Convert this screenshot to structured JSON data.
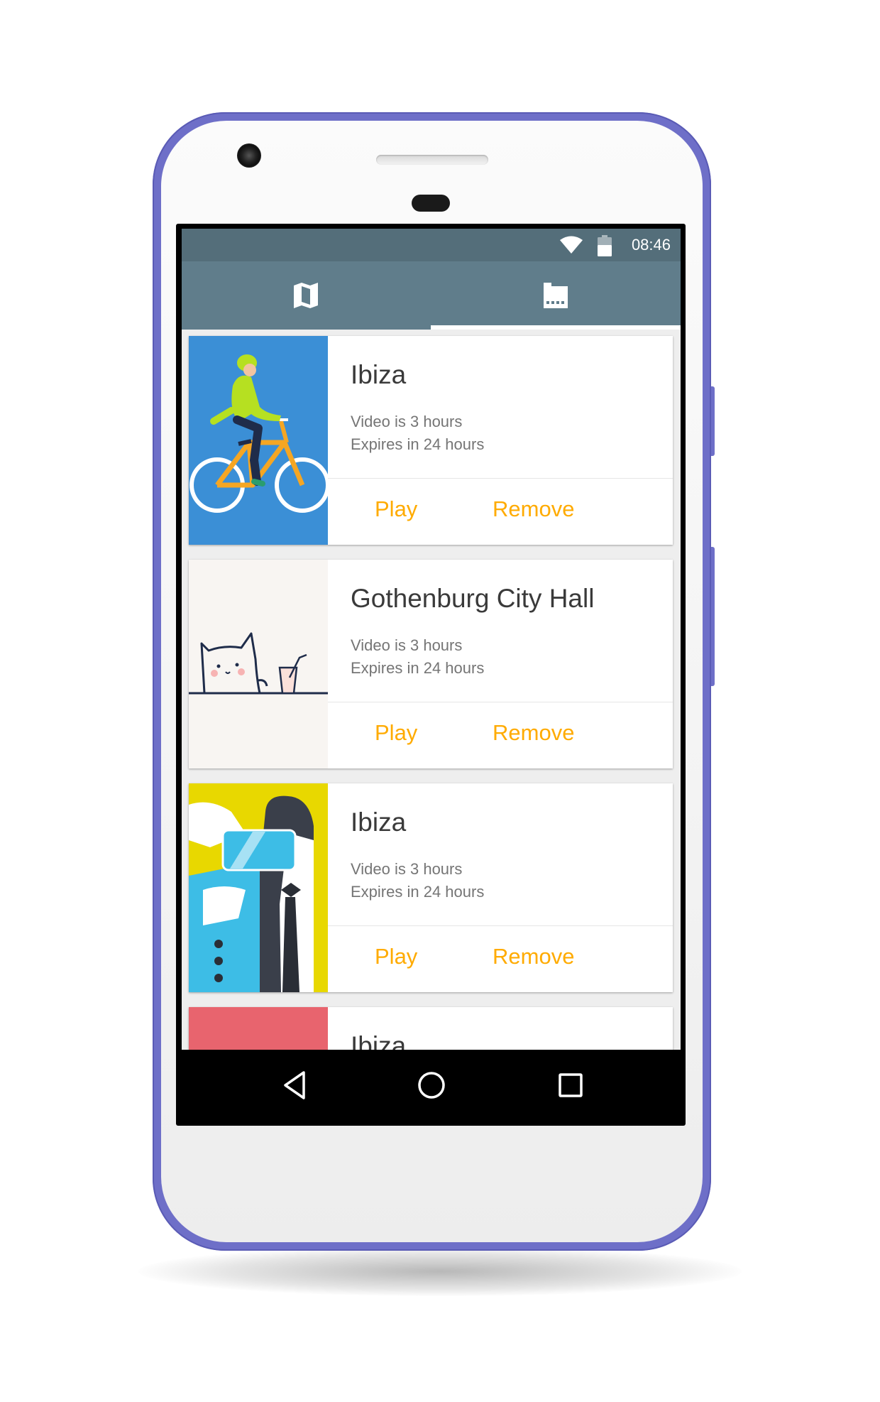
{
  "status_bar": {
    "time": "08:46",
    "icons": [
      "wifi-icon",
      "battery-icon"
    ],
    "background": "#546e7a"
  },
  "tabs": [
    {
      "icon": "map-icon",
      "selected": false
    },
    {
      "icon": "video-library-icon",
      "selected": true
    }
  ],
  "colors": {
    "toolbar": "#607d8b",
    "accent": "#ffab00",
    "phone_body": "#6e6fc8",
    "card_bg": "#ffffff",
    "list_bg": "#eeeeee"
  },
  "cards": [
    {
      "title": "Ibiza",
      "line1": "Video is 3 hours",
      "line2": "Expires in 24 hours",
      "play": "Play",
      "remove": "Remove",
      "image": "cyclist-illustration",
      "image_bg": "#3b8fd6"
    },
    {
      "title": "Gothenburg City Hall",
      "line1": "Video is 3 hours",
      "line2": "Expires in 24 hours",
      "play": "Play",
      "remove": "Remove",
      "image": "cat-illustration",
      "image_bg": "#f8f5f2"
    },
    {
      "title": "Ibiza",
      "line1": "Video is 3 hours",
      "line2": "Expires in 24 hours",
      "play": "Play",
      "remove": "Remove",
      "image": "vr-headset-illustration",
      "image_bg": "#e8d800"
    },
    {
      "title": "Ibiza",
      "image": "coral-illustration",
      "image_bg": "#e8646e"
    }
  ],
  "nav_bar": {
    "buttons": [
      "back-icon",
      "home-icon",
      "recents-icon"
    ]
  }
}
